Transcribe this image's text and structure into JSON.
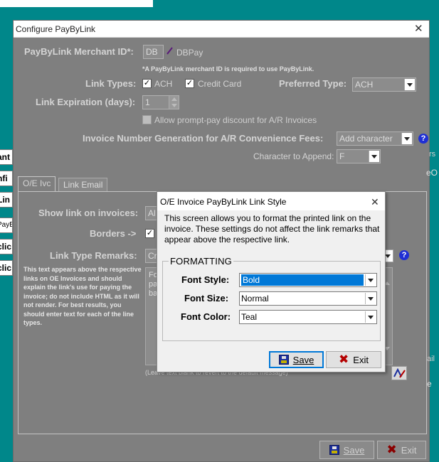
{
  "window": {
    "title": "Configure PayByLink",
    "merchant_id_label": "PayByLink Merchant ID*:",
    "merchant_id_value": "DB",
    "merchant_name": "DBPay",
    "merchant_note": "*A PayByLink merchant ID is required to use PayByLink.",
    "link_types_label": "Link Types:",
    "link_type_ach": "ACH",
    "link_type_cc": "Credit Card",
    "preferred_type_label": "Preferred Type:",
    "preferred_type_value": "ACH",
    "expiration_label": "Link Expiration (days):",
    "expiration_value": "1",
    "prompt_pay_label": "Allow prompt-pay discount for A/R Invoices",
    "invoice_gen_label": "Invoice Number Generation for A/R Convenience Fees:",
    "invoice_gen_value": "Add character",
    "char_append_label": "Character to Append:",
    "char_append_value": "F",
    "help_glyph": "?",
    "save_label": "Save",
    "exit_label": "Exit"
  },
  "tabs": [
    {
      "label": "O/E Ivc"
    },
    {
      "label": "Link Email"
    }
  ],
  "tab_content": {
    "show_link_label": "Show link on invoices:",
    "show_link_value": "Al",
    "borders_label": "Borders ->",
    "remarks_label": "Link Type Remarks:",
    "remarks_value": "Cr",
    "side_note": "This text appears above the respective links on OE Invoices and should explain the link's use for paying the invoice; do not include HTML as it will not render.  For best results, you should enter text for each of the line types.",
    "textarea_peek_1": "Fo",
    "textarea_peek_2": "pa",
    "textarea_peek_3": "ba",
    "blank_note": "(Leave text blank to revert to the default message)"
  },
  "background_fragments": {
    "frag_1": "ant",
    "frag_2": "nfi",
    "frag_3": "Lin",
    "frag_4": "PayB",
    "frag_5": "clic",
    "frag_6": "clic",
    "right_1": "rs",
    "right_2": "eO",
    "right_3": "ail",
    "right_4": "e"
  },
  "dialog": {
    "title": "O/E Invoice PayByLink Link Style",
    "description": "This screen allows you to format the printed link on the invoice.  These settings do not affect the link remarks that appear above the respective link.",
    "group_title": "FORMATTING",
    "font_style_label": "Font Style:",
    "font_style_value": "Bold",
    "font_size_label": "Font Size:",
    "font_size_value": "Normal",
    "font_color_label": "Font Color:",
    "font_color_value": "Teal",
    "save_label": "Save",
    "exit_label": "Exit"
  },
  "colors": {
    "desktop": "#00878a",
    "window_bg": "#7f7f7f",
    "selection": "#0078d7",
    "help_icon": "#1f2fd4"
  }
}
